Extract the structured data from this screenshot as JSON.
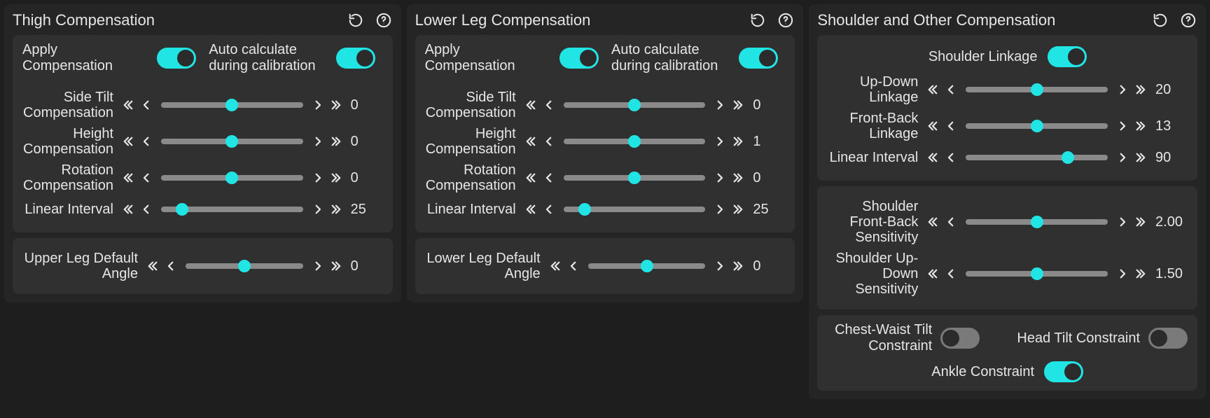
{
  "common": {
    "apply_compensation": "Apply Compensation",
    "auto_calculate": "Auto calculate during calibration"
  },
  "thigh": {
    "title": "Thigh Compensation",
    "toggles": {
      "apply": true,
      "auto": true
    },
    "sliders": {
      "side_tilt": {
        "label": "Side Tilt Compensation",
        "value": "0",
        "pos": 50
      },
      "height": {
        "label": "Height Compensation",
        "value": "0",
        "pos": 50
      },
      "rotation": {
        "label": "Rotation Compensation",
        "value": "0",
        "pos": 50
      },
      "linear": {
        "label": "Linear Interval",
        "value": "25",
        "pos": 15
      }
    },
    "default_angle": {
      "label": "Upper Leg Default Angle",
      "value": "0",
      "pos": 50
    }
  },
  "lower": {
    "title": "Lower Leg Compensation",
    "toggles": {
      "apply": true,
      "auto": true
    },
    "sliders": {
      "side_tilt": {
        "label": "Side Tilt Compensation",
        "value": "0",
        "pos": 50
      },
      "height": {
        "label": "Height Compensation",
        "value": "1",
        "pos": 50
      },
      "rotation": {
        "label": "Rotation Compensation",
        "value": "0",
        "pos": 50
      },
      "linear": {
        "label": "Linear Interval",
        "value": "25",
        "pos": 15
      }
    },
    "default_angle": {
      "label": "Lower Leg Default Angle",
      "value": "0",
      "pos": 50
    }
  },
  "shoulder": {
    "title": "Shoulder and Other Compensation",
    "linkage_toggle": {
      "label": "Shoulder Linkage",
      "on": true
    },
    "group1": {
      "updown": {
        "label": "Up-Down Linkage",
        "value": "20",
        "pos": 50
      },
      "frontback": {
        "label": "Front-Back Linkage",
        "value": "13",
        "pos": 50
      },
      "linear": {
        "label": "Linear Interval",
        "value": "90",
        "pos": 72
      }
    },
    "group2": {
      "fb_sens": {
        "label": "Shoulder Front-Back Sensitivity",
        "value": "2.00",
        "pos": 50
      },
      "ud_sens": {
        "label": "Shoulder Up-Down Sensitivity",
        "value": "1.50",
        "pos": 50
      }
    },
    "constraints": {
      "chest_waist": {
        "label": "Chest-Waist Tilt Constraint",
        "on": false
      },
      "head_tilt": {
        "label": "Head Tilt Constraint",
        "on": false
      },
      "ankle": {
        "label": "Ankle Constraint",
        "on": true
      }
    }
  }
}
